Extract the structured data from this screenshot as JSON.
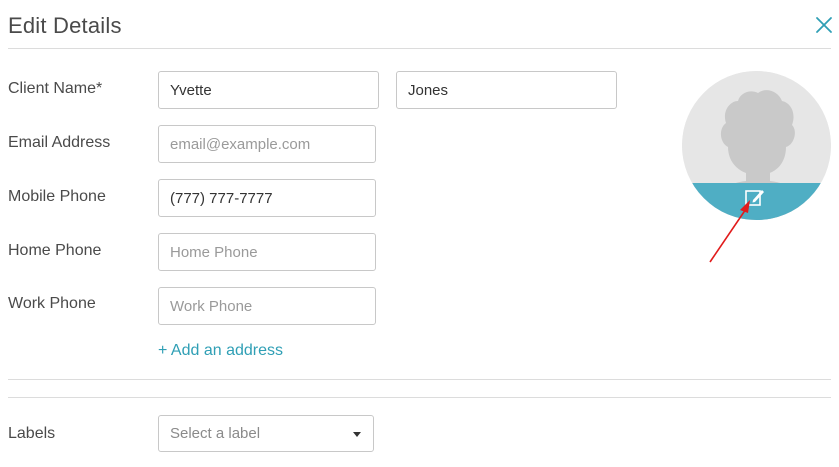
{
  "header": {
    "title": "Edit Details",
    "close_icon": "close-icon"
  },
  "form": {
    "client_name_label": "Client Name*",
    "first_name_value": "Yvette",
    "last_name_value": "Jones",
    "email_label": "Email Address",
    "email_placeholder": "email@example.com",
    "mobile_label": "Mobile Phone",
    "mobile_value": "(777) 777-7777",
    "home_label": "Home Phone",
    "home_placeholder": "Home Phone",
    "work_label": "Work Phone",
    "work_placeholder": "Work Phone",
    "add_address_label": "+ Add an address"
  },
  "labels": {
    "label": "Labels",
    "select_placeholder": "Select a label"
  },
  "avatar": {
    "icon": "avatar-silhouette",
    "edit_icon": "edit-pencil-icon",
    "accent_color": "#4faec4"
  },
  "colors": {
    "link": "#2f9fb5",
    "close": "#2f9fb5",
    "annotation_arrow": "#e11b1b"
  }
}
